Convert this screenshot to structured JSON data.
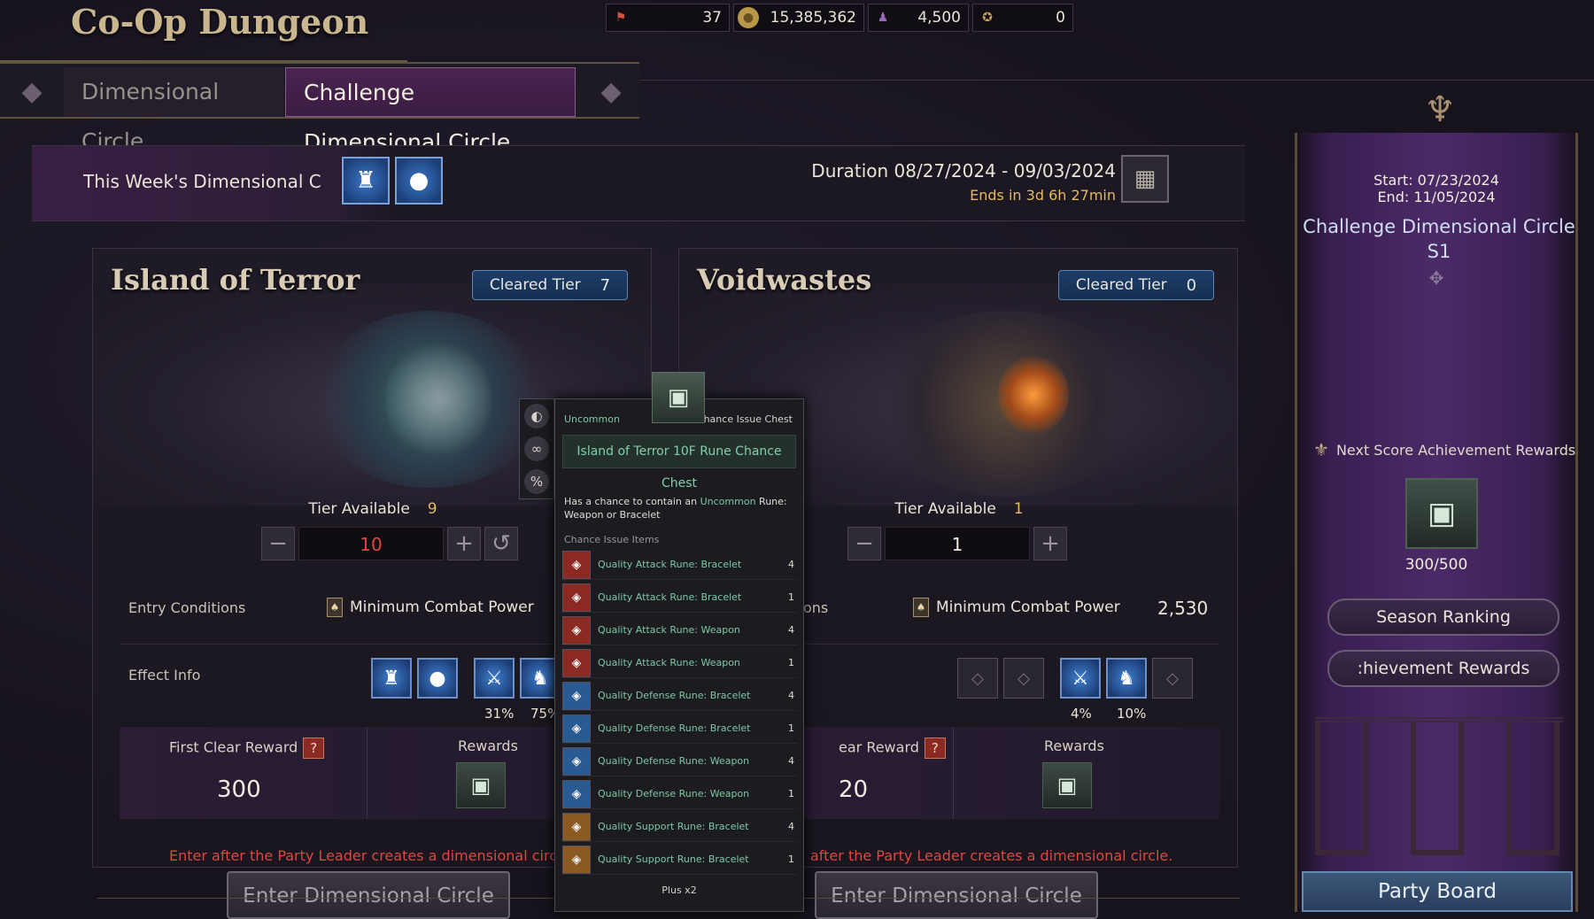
{
  "app": {
    "title": "Co-Op Dungeon"
  },
  "currencies": [
    {
      "icon": "flag-icon",
      "value": "37"
    },
    {
      "icon": "gold-coin-icon",
      "value": "15,385,362"
    },
    {
      "icon": "hooded-figure-icon",
      "value": "4,500"
    },
    {
      "icon": "crest-icon",
      "value": "0"
    }
  ],
  "tabs": [
    {
      "label": "Dimensional Circle",
      "active": false
    },
    {
      "label": "Challenge Dimensional Circle",
      "active": true
    }
  ],
  "week": {
    "label": "This Week's Dimensional Ci",
    "duration": "Duration 08/27/2024 - 09/03/2024",
    "ends": "Ends in 3d 6h 27min"
  },
  "dungeons": [
    {
      "name": "Island of Terror",
      "cleared_label": "Cleared Tier",
      "cleared_value": "7",
      "tier_available_label": "Tier Available",
      "tier_available_value": "9",
      "tier_selected": "10",
      "entry_label": "Entry Conditions",
      "min_cp_label": "Minimum Combat Power",
      "effect_label": "Effect Info",
      "effect_pcts": [
        "31%",
        "75%"
      ],
      "first_clear_label": "First Clear Reward",
      "first_clear_value": "300",
      "rewards_label": "Rewards",
      "warning": "Enter after the Party Leader creates a dimensional circl",
      "enter_label": "Enter Dimensional Circle"
    },
    {
      "name": "Voidwastes",
      "cleared_label": "Cleared Tier",
      "cleared_value": "0",
      "tier_available_label": "Tier Available",
      "tier_available_value": "1",
      "tier_selected": "1",
      "entry_label": "ons",
      "min_cp_label": "Minimum Combat Power",
      "min_cp_value": "2,530",
      "effect_pcts": [
        "4%",
        "10%"
      ],
      "first_clear_label": "ear Reward",
      "first_clear_value": "20",
      "rewards_label": "Rewards",
      "warning": "after the Party Leader creates a dimensional circle.",
      "enter_label": "Enter Dimensional Circle"
    }
  ],
  "season": {
    "start": "Start: 07/23/2024",
    "end": "End: 11/05/2024",
    "title": "Challenge Dimensional Circle S1",
    "next_score_label": "Next Score Achievement Rewards",
    "score": "300/500",
    "season_ranking": "Season Ranking",
    "achievement_rewards": ":hievement Rewards",
    "party_board": "Party Board"
  },
  "tooltip": {
    "rarity": "Uncommon",
    "type": "Chance Issue Chest",
    "name": "Island of Terror 10F Rune Chance Chest",
    "desc_prefix": "Has a chance to contain an",
    "desc_rarity": "Uncommon",
    "desc_suffix": "Rune: Weapon or Bracelet",
    "section": "Chance Issue Items",
    "items": [
      {
        "name": "Quality Attack Rune: Bracelet",
        "qty": "4",
        "color": "#8a2a22"
      },
      {
        "name": "Quality Attack Rune: Bracelet",
        "qty": "1",
        "color": "#8a2a22"
      },
      {
        "name": "Quality Attack Rune: Weapon",
        "qty": "4",
        "color": "#8a2a22"
      },
      {
        "name": "Quality Attack Rune: Weapon",
        "qty": "1",
        "color": "#8a2a22"
      },
      {
        "name": "Quality Defense Rune: Bracelet",
        "qty": "4",
        "color": "#2a5a92"
      },
      {
        "name": "Quality Defense Rune: Bracelet",
        "qty": "1",
        "color": "#2a5a92"
      },
      {
        "name": "Quality Defense Rune: Weapon",
        "qty": "4",
        "color": "#2a5a92"
      },
      {
        "name": "Quality Defense Rune: Weapon",
        "qty": "1",
        "color": "#2a5a92"
      },
      {
        "name": "Quality Support Rune: Bracelet",
        "qty": "4",
        "color": "#8a5a22"
      },
      {
        "name": "Quality Support Rune: Bracelet",
        "qty": "1",
        "color": "#8a5a22"
      }
    ],
    "plus": "Plus x2"
  }
}
